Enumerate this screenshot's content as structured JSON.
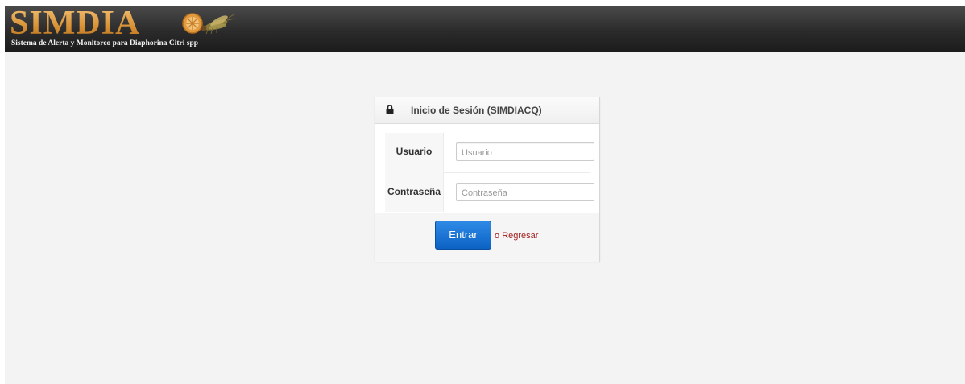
{
  "header": {
    "logo_text": "SIMDIA",
    "logo_subtitle": "Sistema de Alerta y Monitoreo para Diaphorina Citri spp",
    "colors": {
      "bar": "#2b2b2b",
      "logo": "#e0a552"
    }
  },
  "login": {
    "icon": "lock-icon",
    "title": "Inicio de Sesión (SIMDIACQ)",
    "username": {
      "label": "Usuario",
      "placeholder": "Usuario",
      "value": ""
    },
    "password": {
      "label": "Contraseña",
      "placeholder": "Contraseña",
      "value": ""
    },
    "submit_label": "Entrar",
    "or_text": "o",
    "back_label": "Regresar",
    "colors": {
      "button": "#0b62c4",
      "link": "#a31c1c"
    }
  }
}
